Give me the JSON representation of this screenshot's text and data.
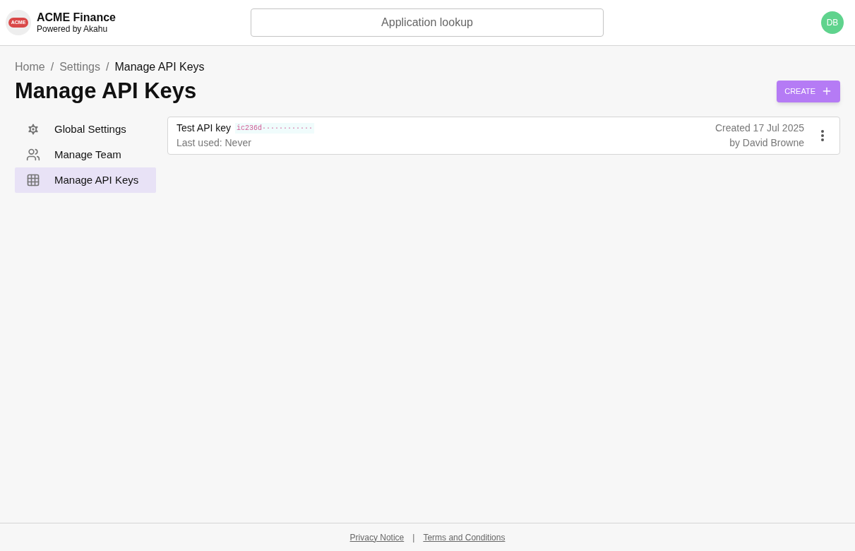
{
  "header": {
    "logo_text": "ACME",
    "brand": "ACME Finance",
    "tagline": "Powered by Akahu",
    "search": {
      "placeholder": "Application lookup"
    },
    "avatar": "DB"
  },
  "breadcrumbs": [
    {
      "label": "Home",
      "current": false
    },
    {
      "label": "Settings",
      "current": false
    },
    {
      "label": "Manage API Keys",
      "current": true
    }
  ],
  "breadcrumb_separator": "/",
  "title": "Manage API Keys",
  "create_button": "CREATE",
  "sidebar": {
    "items": [
      {
        "kind": "gear",
        "label": "Global Settings",
        "selected": false
      },
      {
        "kind": "people",
        "label": "Manage Team",
        "selected": false
      },
      {
        "kind": "grid",
        "label": "Manage API Keys",
        "selected": true
      }
    ]
  },
  "api_keys": [
    {
      "name": "Test API key",
      "key": "ic236d············",
      "last_used": "Last used: Never",
      "created": "Created 17 Jul 2025",
      "created_by": "by David Browne"
    }
  ],
  "footer": {
    "links": [
      "Privacy Notice",
      "Terms and Conditions"
    ],
    "separator": "|"
  }
}
